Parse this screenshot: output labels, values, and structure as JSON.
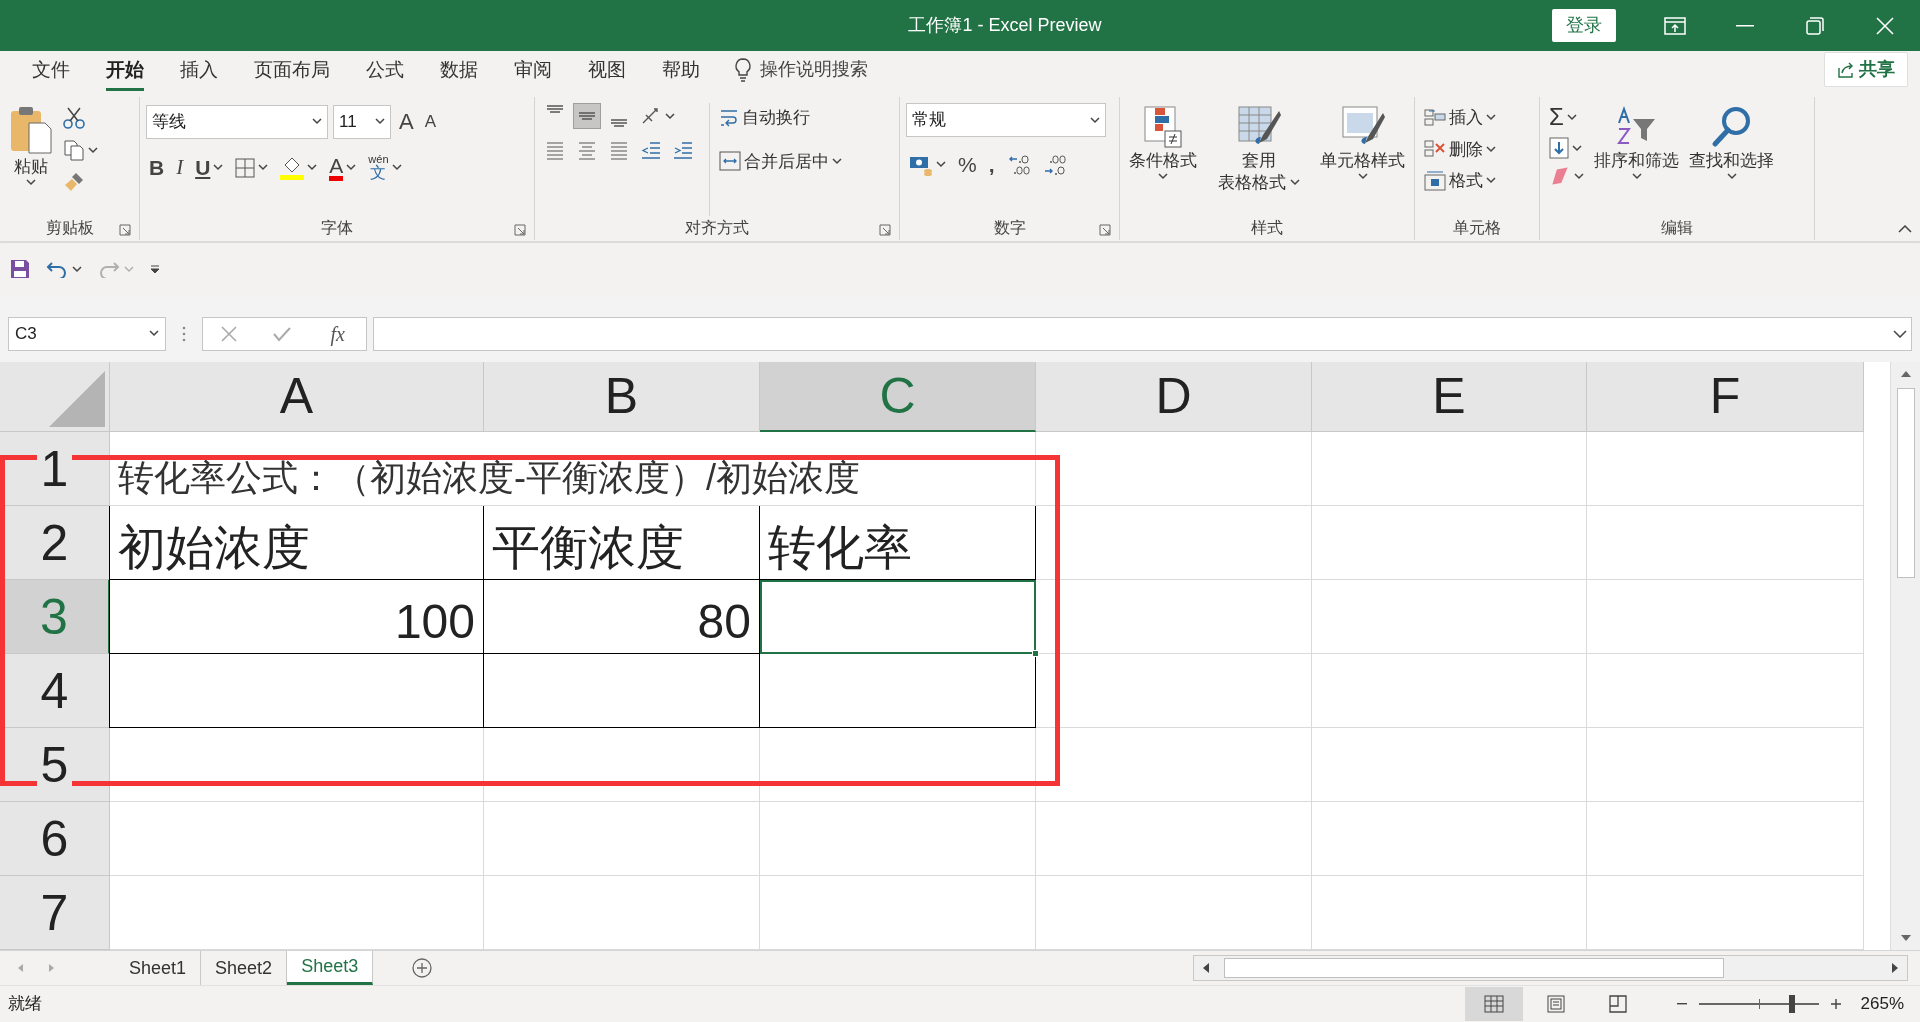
{
  "window": {
    "title": "工作簿1  -  Excel Preview",
    "sign_in": "登录"
  },
  "ribbon_tabs": [
    {
      "label": "文件",
      "selected": false
    },
    {
      "label": "开始",
      "selected": true
    },
    {
      "label": "插入",
      "selected": false
    },
    {
      "label": "页面布局",
      "selected": false
    },
    {
      "label": "公式",
      "selected": false
    },
    {
      "label": "数据",
      "selected": false
    },
    {
      "label": "审阅",
      "selected": false
    },
    {
      "label": "视图",
      "selected": false
    },
    {
      "label": "帮助",
      "selected": false
    }
  ],
  "tell_me": "操作说明搜索",
  "share": "共享",
  "ribbon": {
    "clipboard": {
      "paste": "粘贴",
      "label": "剪贴板"
    },
    "font": {
      "name": "等线",
      "size": "11",
      "grow": "A",
      "shrink": "A",
      "bold": "B",
      "italic": "I",
      "underline": "U",
      "color_glyph": "A",
      "phonetic": "wén",
      "phonetic_char": "文",
      "label": "字体"
    },
    "alignment": {
      "vertical": [
        {
          "selected": false
        },
        {
          "selected": true
        },
        {
          "selected": false
        }
      ],
      "wrap": "自动换行",
      "merge": "合并后居中",
      "label": "对齐方式"
    },
    "number": {
      "format": "常规",
      "percent": "%",
      "comma": ",",
      "label": "数字"
    },
    "styles": {
      "conditional": "条件格式",
      "table_top": "套用",
      "table_bottom": "表格格式",
      "cell_styles": "单元格样式",
      "label": "样式"
    },
    "cells": {
      "insert": "插入",
      "delete": "删除",
      "format": "格式",
      "label": "单元格"
    },
    "editing": {
      "sum": "Σ",
      "sort": "排序和筛选",
      "find": "查找和选择",
      "label": "编辑"
    }
  },
  "formula_bar": {
    "name_box": "C3",
    "fx": "fx"
  },
  "columns": [
    {
      "label": "A",
      "selected": false
    },
    {
      "label": "B",
      "selected": false
    },
    {
      "label": "C",
      "selected": true
    },
    {
      "label": "D",
      "selected": false
    },
    {
      "label": "E",
      "selected": false
    },
    {
      "label": "F",
      "selected": false
    }
  ],
  "rows": [
    {
      "header": "1",
      "selected": false,
      "cells": [
        {
          "text": "转化率公式：（初始浓度-平衡浓度）/初始浓度",
          "kind": "text",
          "bordered": false,
          "selected": false
        }
      ]
    },
    {
      "header": "2",
      "selected": false,
      "cells": [
        {
          "text": "初始浓度",
          "kind": "text",
          "bordered": true,
          "selected": false
        },
        {
          "text": "平衡浓度",
          "kind": "text",
          "bordered": true,
          "selected": false
        },
        {
          "text": "转化率",
          "kind": "text",
          "bordered": true,
          "selected": false
        }
      ]
    },
    {
      "header": "3",
      "selected": true,
      "cells": [
        {
          "text": "100",
          "kind": "number",
          "bordered": true,
          "selected": false
        },
        {
          "text": "80",
          "kind": "number",
          "bordered": true,
          "selected": false
        },
        {
          "bordered": true,
          "selected": true
        }
      ]
    },
    {
      "header": "4",
      "selected": false,
      "cells": [
        {
          "bordered": true,
          "selected": false
        },
        {
          "bordered": true,
          "selected": false
        },
        {
          "bordered": true,
          "selected": false
        }
      ]
    },
    {
      "header": "5",
      "selected": false,
      "cells": []
    },
    {
      "header": "6",
      "selected": false,
      "cells": []
    },
    {
      "header": "7",
      "selected": false,
      "cells": []
    }
  ],
  "annotation": {
    "kind": "rectangle"
  },
  "sheets": [
    {
      "label": "Sheet1",
      "selected": false
    },
    {
      "label": "Sheet2",
      "selected": false
    },
    {
      "label": "Sheet3",
      "selected": true
    }
  ],
  "status": {
    "text": "就绪",
    "zoom": "265%"
  },
  "zoom_slider": {
    "level": 0.78
  }
}
